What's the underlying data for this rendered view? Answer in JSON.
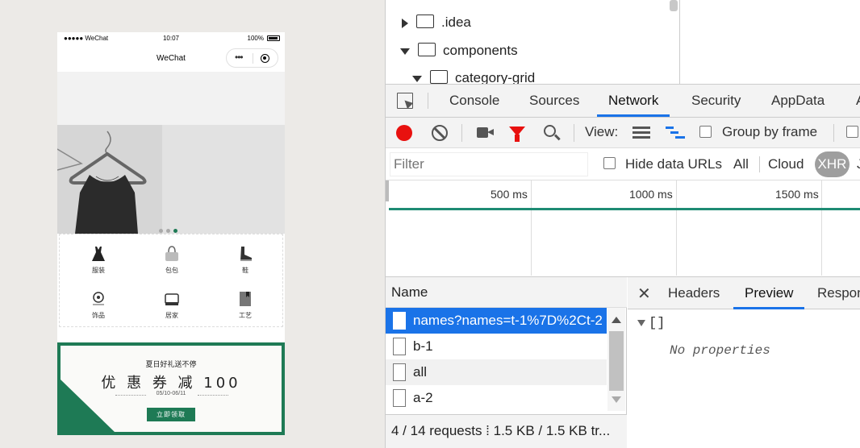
{
  "phone": {
    "status": {
      "carrier": "●●●●● WeChat",
      "time": "10:07",
      "battery": "100%"
    },
    "nav_title": "WeChat",
    "capsule_dots": "•••",
    "categories": [
      {
        "label": "服装",
        "icon": "dress-icon"
      },
      {
        "label": "包包",
        "icon": "handbag-icon"
      },
      {
        "label": "鞋",
        "icon": "shoe-icon"
      },
      {
        "label": "饰品",
        "icon": "accessory-icon"
      },
      {
        "label": "居家",
        "icon": "home-goods-icon"
      },
      {
        "label": "工艺",
        "icon": "craft-icon"
      }
    ],
    "coupon": {
      "subtitle": "夏日好礼送不停",
      "title": "优 惠 券 减 100",
      "date": "05/10-06/11",
      "button": "立即领取"
    },
    "accent_color": "#1e7a55"
  },
  "devtools": {
    "tree": [
      {
        "label": ".idea",
        "expanded": false
      },
      {
        "label": "components",
        "expanded": true
      },
      {
        "label": "category-grid",
        "expanded": true
      }
    ],
    "tabs": [
      "Console",
      "Sources",
      "Network",
      "Security",
      "AppData",
      "A"
    ],
    "active_tab": "Network",
    "toolbar": {
      "view_label": "View:",
      "group_label": "Group by frame"
    },
    "filter": {
      "placeholder": "Filter",
      "hide_label": "Hide data URLs",
      "types": [
        "All",
        "Cloud",
        "XHR",
        "J"
      ]
    },
    "timeline": {
      "labels": [
        "500 ms",
        "1000 ms",
        "1500 ms"
      ]
    },
    "name_header": "Name",
    "requests": [
      "names?names=t-1%7D%2Ct-2",
      "b-1",
      "all",
      "a-2"
    ],
    "summary": "4 / 14 requests  ⁞  1.5 KB / 1.5 KB tr...",
    "detail_tabs": [
      "Headers",
      "Preview",
      "Respon"
    ],
    "preview": {
      "root": "[]",
      "empty": "No properties"
    }
  }
}
